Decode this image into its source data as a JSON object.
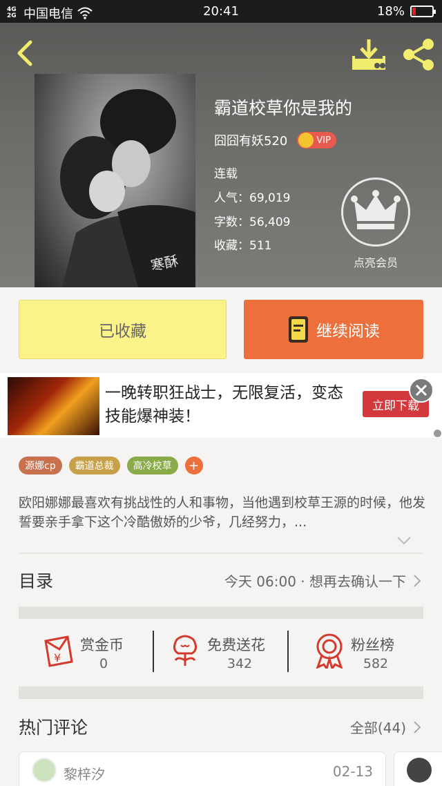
{
  "status_bar": {
    "network": "4G 2G",
    "carrier": "中国电信",
    "time": "20:41",
    "battery": "18%",
    "battery_level": 0.18
  },
  "book": {
    "title": "霸道校草你是我的",
    "author": "囧囧有妖520",
    "vip_badge": "VIP",
    "status": "连载",
    "popularity": "人气：69,019",
    "word_count": "字数：56,409",
    "collections": "收藏：511",
    "member_label": "点亮会员",
    "cover_text": "寒酥"
  },
  "actions": {
    "favorited_label": "已收藏",
    "continue_label": "继续阅读"
  },
  "ad": {
    "text": "一晚转职狂战士，无限复活，变态技能爆神装！",
    "button": "立即下载"
  },
  "tags": [
    {
      "label": "源娜cp",
      "color": "#c9714f"
    },
    {
      "label": "霸道总裁",
      "color": "#c9a04a"
    },
    {
      "label": "高冷校草",
      "color": "#8aab4a"
    }
  ],
  "tag_add": "+",
  "description": "欧阳娜娜最喜欢有挑战性的人和事物，当他遇到校草王源的时候，他发誓要亲手拿下这个冷酷傲娇的少爷，几经努力，...",
  "catalog": {
    "title": "目录",
    "latest": "今天 06:00 · 想再去确认一下"
  },
  "stats": [
    {
      "label": "赏金币",
      "value": "0",
      "icon": "red-envelope-icon"
    },
    {
      "label": "免费送花",
      "value": "342",
      "icon": "flower-icon"
    },
    {
      "label": "粉丝榜",
      "value": "582",
      "icon": "medal-icon"
    }
  ],
  "comments": {
    "title": "热门评论",
    "all": "全部(44)",
    "first": {
      "name": "黎梓汐",
      "date": "02-13"
    }
  },
  "colors": {
    "accent": "#ec6f3c",
    "favorite_bg": "#fbf38a",
    "icon_yellow": "#f2ec6e",
    "icon_red": "#d3392c"
  }
}
